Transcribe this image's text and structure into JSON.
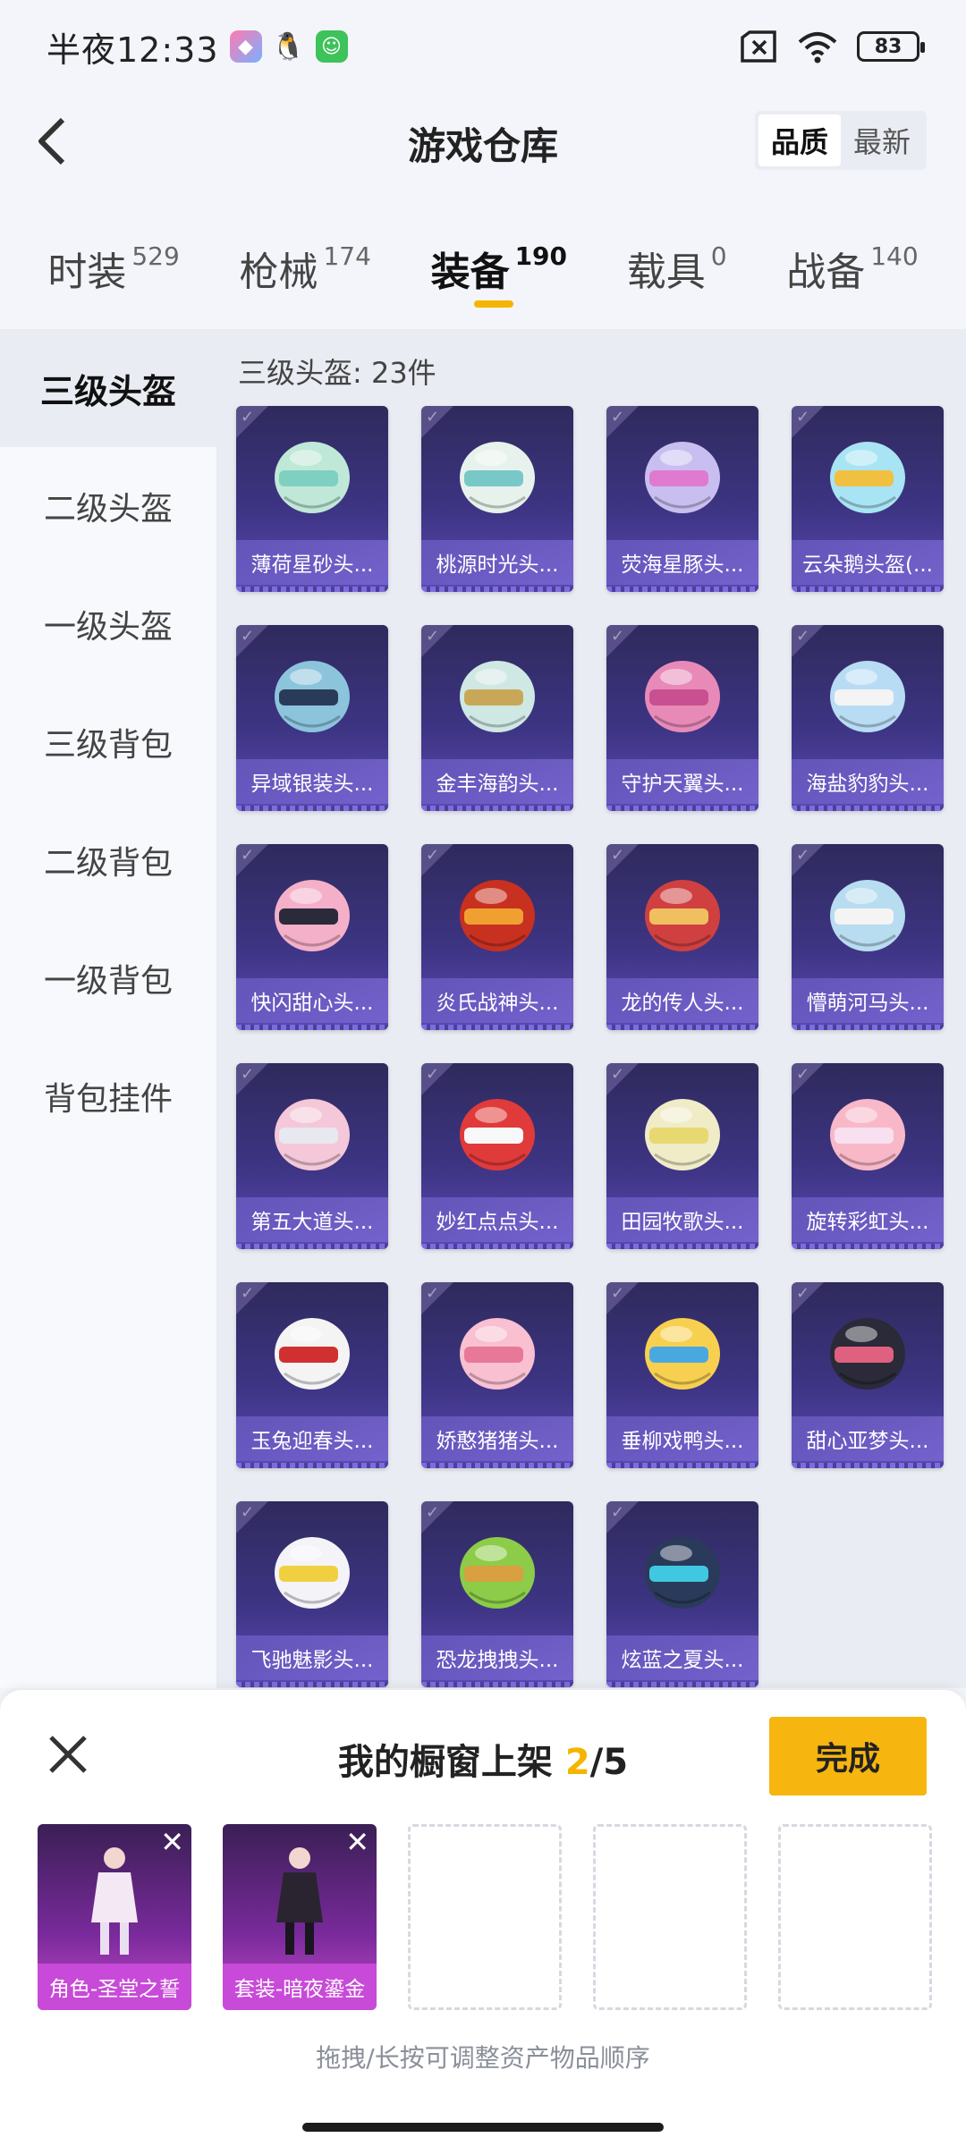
{
  "status": {
    "time": "半夜12:33",
    "battery": "83"
  },
  "header": {
    "title": "游戏仓库",
    "sort_options": [
      "品质",
      "最新"
    ],
    "sort_active": 0
  },
  "categories": [
    {
      "name": "时装",
      "count": "529"
    },
    {
      "name": "枪械",
      "count": "174"
    },
    {
      "name": "装备",
      "count": "190"
    },
    {
      "name": "载具",
      "count": "0"
    },
    {
      "name": "战备",
      "count": "140"
    }
  ],
  "categories_active": 2,
  "sidebar": {
    "items": [
      "三级头盔",
      "二级头盔",
      "一级头盔",
      "三级背包",
      "二级背包",
      "一级背包",
      "背包挂件"
    ],
    "active": 0
  },
  "grid": {
    "title": "三级头盔: 23件",
    "items": [
      {
        "label": "薄荷星砂头...",
        "color": "#bfe8d8",
        "accent": "#7fd0c0"
      },
      {
        "label": "桃源时光头...",
        "color": "#e8f2ec",
        "accent": "#78c8c8"
      },
      {
        "label": "荧海星豚头...",
        "color": "#c8bff0",
        "accent": "#e07ad0"
      },
      {
        "label": "云朵鹅头盔(...",
        "color": "#a8e4f4",
        "accent": "#f0c040"
      },
      {
        "label": "异域银装头...",
        "color": "#8cc4dc",
        "accent": "#2a3b5a"
      },
      {
        "label": "金丰海韵头...",
        "color": "#cfe8e4",
        "accent": "#c8a858"
      },
      {
        "label": "守护天翼头...",
        "color": "#e88ab8",
        "accent": "#c85090"
      },
      {
        "label": "海盐豹豹头...",
        "color": "#b8dcf4",
        "accent": "#f4f4f4"
      },
      {
        "label": "快闪甜心头...",
        "color": "#f4b0c8",
        "accent": "#2a2a3a"
      },
      {
        "label": "炎氏战神头...",
        "color": "#c83020",
        "accent": "#f0a030"
      },
      {
        "label": "龙的传人头...",
        "color": "#d04040",
        "accent": "#f0c060"
      },
      {
        "label": "懵萌河马头...",
        "color": "#b8dcf0",
        "accent": "#f4f4f4"
      },
      {
        "label": "第五大道头...",
        "color": "#f4c8d8",
        "accent": "#e8e8f0"
      },
      {
        "label": "妙红点点头...",
        "color": "#e03a3a",
        "accent": "#f8f8f8"
      },
      {
        "label": "田园牧歌头...",
        "color": "#f0ecc8",
        "accent": "#e8d870"
      },
      {
        "label": "旋转彩虹头...",
        "color": "#f8b8c8",
        "accent": "#f8e0f0"
      },
      {
        "label": "玉兔迎春头...",
        "color": "#f4f4f4",
        "accent": "#d03030"
      },
      {
        "label": "娇憨猪猪头...",
        "color": "#f8c0d0",
        "accent": "#e87898"
      },
      {
        "label": "垂柳戏鸭头...",
        "color": "#f8d050",
        "accent": "#4aa8e0"
      },
      {
        "label": "甜心亚梦头...",
        "color": "#2a2a38",
        "accent": "#e06080"
      },
      {
        "label": "飞驰魅影头...",
        "color": "#f4f4f8",
        "accent": "#f0d040"
      },
      {
        "label": "恐龙拽拽头...",
        "color": "#8ccc48",
        "accent": "#d8a040"
      },
      {
        "label": "炫蓝之夏头...",
        "color": "#2a3a5a",
        "accent": "#40c8e0"
      }
    ]
  },
  "sheet": {
    "title_prefix": "我的橱窗上架 ",
    "current": "2",
    "total": "/5",
    "done_label": "完成",
    "slots": [
      {
        "label": "角色-圣堂之誓",
        "filled": true
      },
      {
        "label": "套装-暗夜鎏金",
        "filled": true
      },
      {
        "label": "",
        "filled": false
      },
      {
        "label": "",
        "filled": false
      },
      {
        "label": "",
        "filled": false
      }
    ],
    "hint": "拖拽/长按可调整资产物品顺序"
  }
}
